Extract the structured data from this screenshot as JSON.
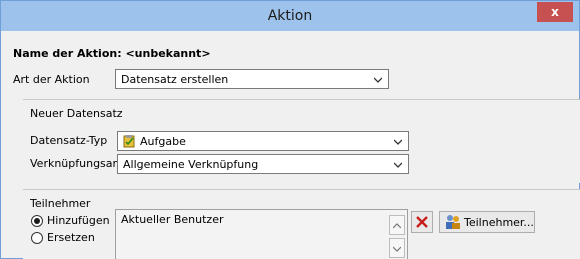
{
  "window": {
    "title": "Aktion",
    "close_label": "x"
  },
  "action_name_label": "Name der Aktion: <unbekannt>",
  "art": {
    "label": "Art der Aktion",
    "value": "Datensatz erstellen"
  },
  "neuer_datensatz": {
    "group_title": "Neuer Datensatz",
    "typ_label": "Datensatz-Typ",
    "typ_value": "Aufgabe",
    "verkn_label": "Verknüpfungsart",
    "verkn_value": "Allgemeine Verknüpfung"
  },
  "teilnehmer": {
    "group_title": "Teilnehmer",
    "hinzufuegen_label": "Hinzufügen",
    "ersetzen_label": "Ersetzen",
    "selected_mode": "Hinzufügen",
    "list_items": [
      "Aktueller Benutzer"
    ],
    "button_label": "Teilnehmer..."
  },
  "colors": {
    "titlebar": "#9dc3ec",
    "close": "#c75050",
    "delete_icon": "#c81e1e"
  }
}
